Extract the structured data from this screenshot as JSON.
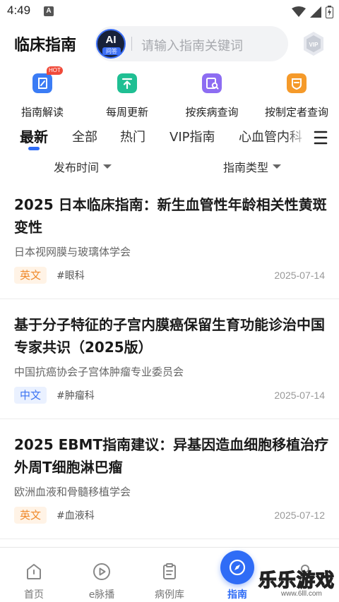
{
  "status_bar": {
    "time": "4:49",
    "notification_badge": "A"
  },
  "header": {
    "title": "临床指南",
    "ai_badge": {
      "label": "AI",
      "sub_label": "问答"
    },
    "search_placeholder": "请输入指南关键词",
    "vip_label": "VIP"
  },
  "quick_actions": [
    {
      "label": "指南解读",
      "icon": "book-icon",
      "color": "#3b7cf5",
      "badge": "HOT"
    },
    {
      "label": "每周更新",
      "icon": "upload-icon",
      "color": "#1fbf93"
    },
    {
      "label": "按疾病查询",
      "icon": "search-document-icon",
      "color": "#8d6df2"
    },
    {
      "label": "按制定者查询",
      "icon": "badge-icon",
      "color": "#f59a2a"
    }
  ],
  "tabs": [
    {
      "label": "最新",
      "active": true
    },
    {
      "label": "全部"
    },
    {
      "label": "热门"
    },
    {
      "label": "VIP指南"
    },
    {
      "label": "心血管内科"
    }
  ],
  "filters": {
    "publish_time": "发布时间",
    "guide_type": "指南类型"
  },
  "articles": [
    {
      "title": "2025 日本临床指南：新生血管性年龄相关性黄斑变性",
      "org": "日本视网膜与玻璃体学会",
      "lang": "英文",
      "dept": "#眼科",
      "date": "2025-07-14"
    },
    {
      "title": "基于分子特征的子宫内膜癌保留生育功能诊治中国专家共识（2025版）",
      "org": "中国抗癌协会子宫体肿瘤专业委员会",
      "lang": "中文",
      "dept": "#肿瘤科",
      "date": "2025-07-14"
    },
    {
      "title": "2025 EBMT指南建议：异基因造血细胞移植治疗外周T细胞淋巴瘤",
      "org": "欧洲血液和骨髓移植学会",
      "lang": "英文",
      "dept": "#血液科",
      "date": "2025-07-12"
    }
  ],
  "bottom_nav": [
    {
      "label": "首页",
      "icon": "home-icon"
    },
    {
      "label": "e脉播",
      "icon": "play-icon"
    },
    {
      "label": "病例库",
      "icon": "clipboard-icon"
    },
    {
      "label": "指南",
      "icon": "compass-icon",
      "active": true
    },
    {
      "label": "",
      "icon": "profile-icon"
    }
  ],
  "watermark": {
    "main": "乐乐游戏",
    "sub": "www.6lll.com"
  },
  "colors": {
    "accent": "#2f6cf6",
    "hot": "#f04a3a",
    "tag_en": "#f08a2c",
    "tag_zh": "#3b73f2"
  }
}
